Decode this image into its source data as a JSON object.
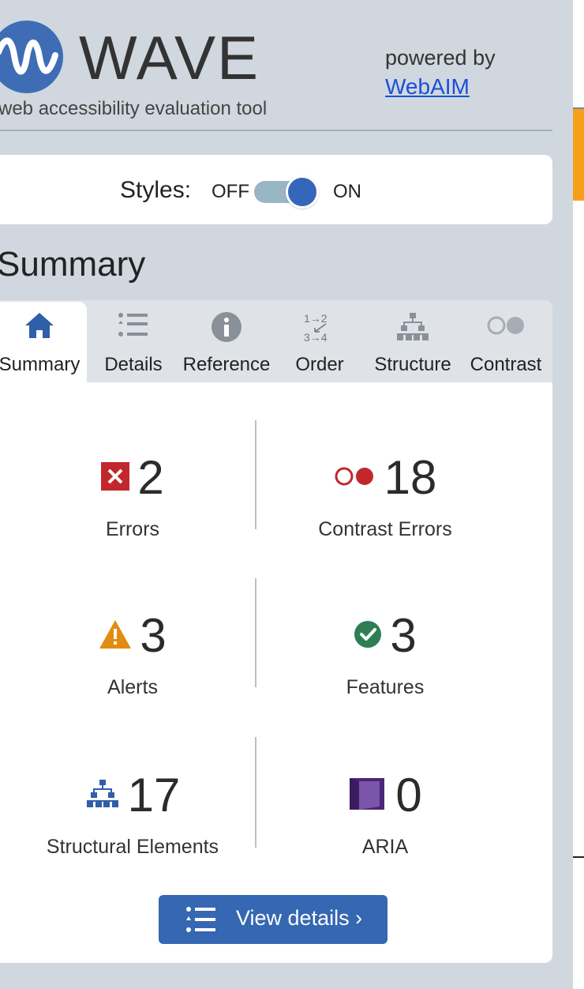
{
  "header": {
    "brand": "WAVE",
    "tagline": "web accessibility evaluation tool",
    "powered_by": "powered by",
    "webaim_link": "WebAIM"
  },
  "styles_toggle": {
    "label": "Styles:",
    "off": "OFF",
    "on": "ON",
    "state": "on"
  },
  "summary_heading": "Summary",
  "tabs": [
    {
      "label": "Summary",
      "icon": "home-icon",
      "active": true
    },
    {
      "label": "Details",
      "icon": "list-icon",
      "active": false
    },
    {
      "label": "Reference",
      "icon": "info-icon",
      "active": false
    },
    {
      "label": "Order",
      "icon": "order-icon",
      "active": false
    },
    {
      "label": "Structure",
      "icon": "structure-icon",
      "active": false
    },
    {
      "label": "Contrast",
      "icon": "contrast-icon",
      "active": false
    }
  ],
  "stats": {
    "errors": {
      "count": "2",
      "label": "Errors",
      "icon": "error-icon"
    },
    "contrast_errors": {
      "count": "18",
      "label": "Contrast Errors",
      "icon": "contrast-error-icon"
    },
    "alerts": {
      "count": "3",
      "label": "Alerts",
      "icon": "alert-icon"
    },
    "features": {
      "count": "3",
      "label": "Features",
      "icon": "feature-icon"
    },
    "structural": {
      "count": "17",
      "label": "Structural Elements",
      "icon": "structure-icon"
    },
    "aria": {
      "count": "0",
      "label": "ARIA",
      "icon": "aria-icon"
    }
  },
  "view_details": "View details ›",
  "colors": {
    "panel_bg": "#d0d7de",
    "accent_blue": "#3567b2",
    "error_red": "#c1272d",
    "alert_orange": "#e38b12",
    "feature_green": "#2f7d55",
    "aria_purple": "#4b2578",
    "link_blue": "#1a4fd8"
  }
}
